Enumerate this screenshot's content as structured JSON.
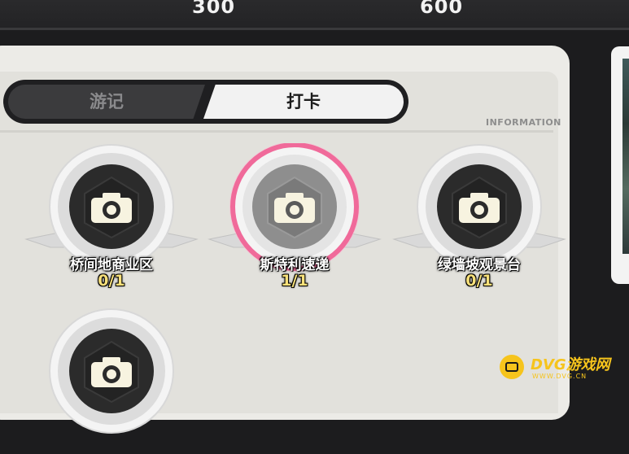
{
  "progress": {
    "milestones": [
      "300",
      "600"
    ]
  },
  "tabs": [
    {
      "label": "游记",
      "active": false
    },
    {
      "label": "打卡",
      "active": true
    }
  ],
  "section_label": "INFORMATION",
  "checkins": [
    {
      "name": "桥间地商业区",
      "count": "0/1",
      "completed": false
    },
    {
      "name": "斯特利速递",
      "count": "1/1",
      "completed": true
    },
    {
      "name": "绿墙坡观景台",
      "count": "0/1",
      "completed": false
    },
    {
      "name": "",
      "count": "",
      "completed": false
    }
  ],
  "watermark": {
    "brand": "DVG游戏网",
    "url": "WWW.DVG.CN"
  },
  "colors": {
    "highlight_ring": "#f06a9a",
    "count_text": "#f7e07a",
    "watermark": "#f6c41c"
  }
}
